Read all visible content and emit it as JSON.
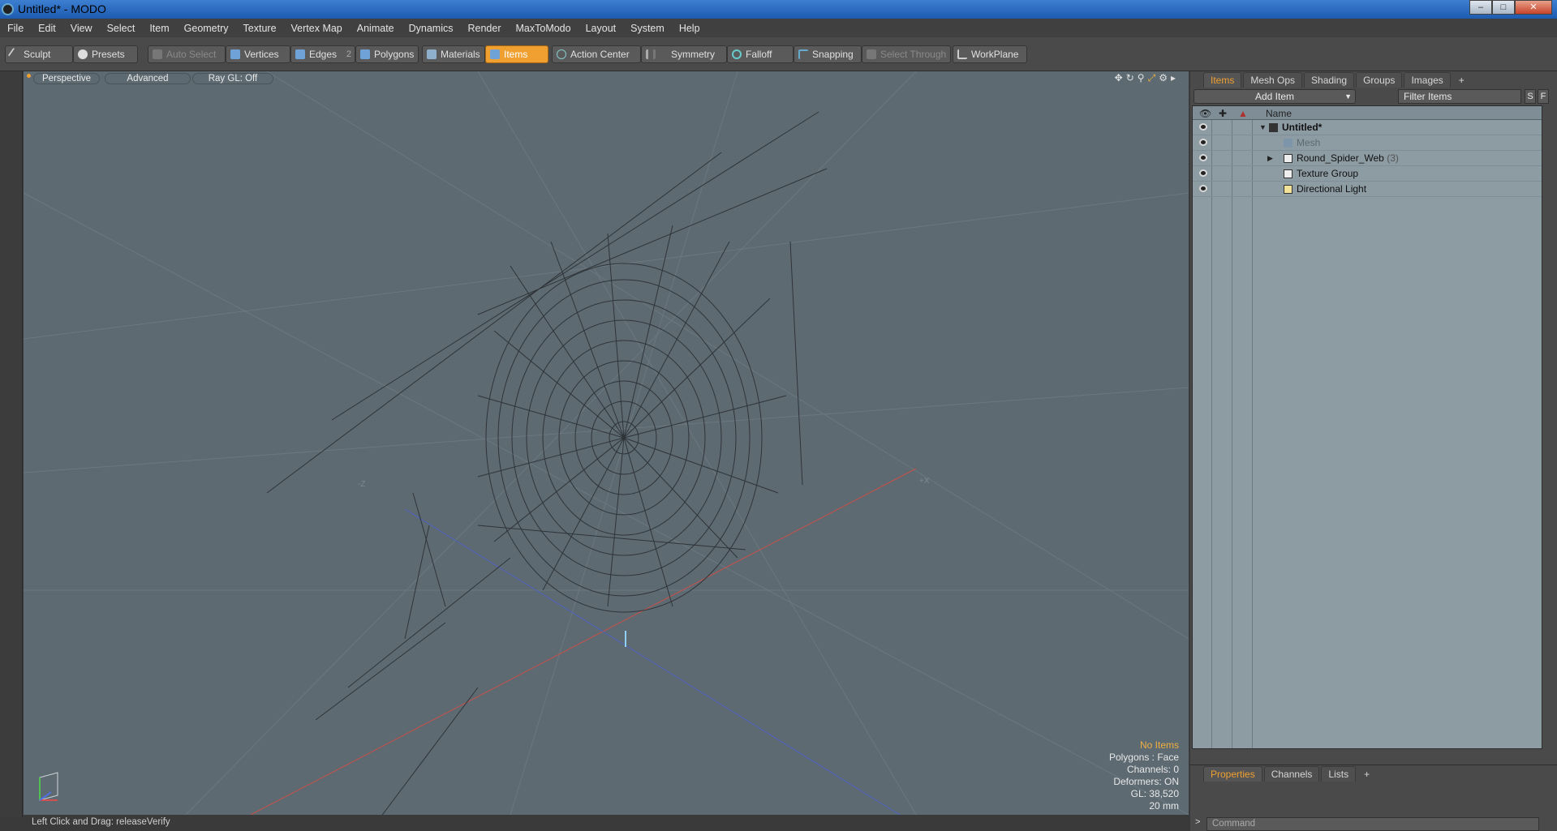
{
  "window": {
    "title": "Untitled* - MODO"
  },
  "menu": [
    "File",
    "Edit",
    "View",
    "Select",
    "Item",
    "Geometry",
    "Texture",
    "Vertex Map",
    "Animate",
    "Dynamics",
    "Render",
    "MaxToModo",
    "Layout",
    "System",
    "Help"
  ],
  "toolbar": {
    "sculpt": "Sculpt",
    "presets": "Presets",
    "auto_select": "Auto Select",
    "vertices": "Vertices",
    "edges": "Edges",
    "edges_count": "2",
    "polygons": "Polygons",
    "materials": "Materials",
    "items": "Items",
    "action_center": "Action Center",
    "symmetry": "Symmetry",
    "falloff": "Falloff",
    "snapping": "Snapping",
    "select_through": "Select Through",
    "workplane": "WorkPlane"
  },
  "viewport": {
    "tabs": [
      "Perspective",
      "Advanced",
      "Ray GL: Off"
    ],
    "info": {
      "selection": "No Items",
      "polygons": "Polygons : Face",
      "channels": "Channels: 0",
      "deformers": "Deformers: ON",
      "gl": "GL: 38,520",
      "scale": "20 mm"
    },
    "axis_labels": {
      "neg_z": "-Z",
      "pos_x": "+X"
    }
  },
  "status": {
    "hint": "Left Click and Drag:  releaseVerify"
  },
  "items_panel": {
    "tabs": [
      "Items",
      "Mesh Ops",
      "Shading",
      "Groups",
      "Images"
    ],
    "add_item": "Add Item",
    "filter_placeholder": "Filter Items",
    "s_btn": "S",
    "f_btn": "F",
    "name_header": "Name",
    "rows": [
      {
        "label": "Untitled*",
        "count": ""
      },
      {
        "label": "Mesh",
        "count": ""
      },
      {
        "label": "Round_Spider_Web",
        "count": "(3)"
      },
      {
        "label": "Texture Group",
        "count": ""
      },
      {
        "label": "Directional Light",
        "count": ""
      }
    ]
  },
  "properties_panel": {
    "tabs": [
      "Properties",
      "Channels",
      "Lists"
    ],
    "command_placeholder": "Command"
  },
  "colors": {
    "accent": "#f0a030",
    "viewport_bg": "#5d6a72",
    "tree_bg": "#8d9ba3"
  }
}
